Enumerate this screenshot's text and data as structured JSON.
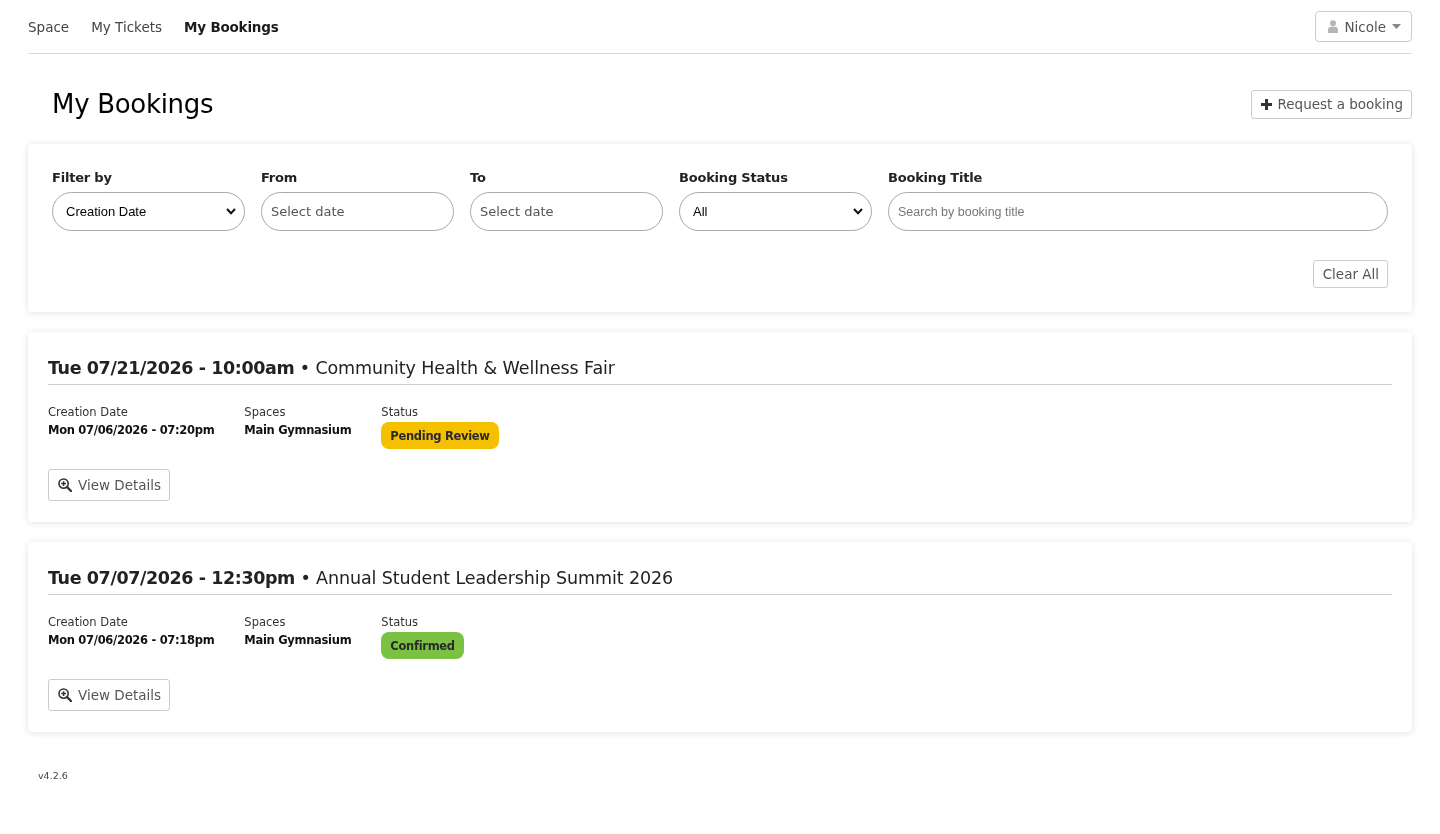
{
  "nav": {
    "tabs": [
      {
        "label": "Space",
        "selected": false
      },
      {
        "label": "My Tickets",
        "selected": false
      },
      {
        "label": "My Bookings",
        "selected": true
      }
    ],
    "user_menu": {
      "label": "Nicole"
    }
  },
  "page": {
    "title": "My Bookings",
    "request_button": "Request a booking"
  },
  "filters": {
    "fields": [
      {
        "kind": "select",
        "label": "Filter by",
        "value": "Creation Date"
      },
      {
        "kind": "date",
        "label": "From",
        "placeholder": "Select date"
      },
      {
        "kind": "date",
        "label": "To",
        "placeholder": "Select date"
      },
      {
        "kind": "select",
        "label": "Booking Status",
        "value": "All"
      },
      {
        "kind": "text",
        "label": "Booking Title",
        "placeholder": "Search by booking title"
      }
    ],
    "clear_button": "Clear All"
  },
  "bookings": [
    {
      "heading": "**Tue 07/21/2026 - 10:00am** • Community Health & Wellness Fair",
      "details": [
        {
          "label": "Creation Date",
          "value": "Mon 07/06/2026 - 07:20pm"
        },
        {
          "label": "Spaces",
          "value": "Main Gymnasium"
        }
      ],
      "status_label": "Status",
      "status": {
        "label": "Pending Review",
        "color": "#f5c000"
      },
      "action": "View Details"
    },
    {
      "heading": "**Tue 07/07/2026 - 12:30pm** • Annual Student Leadership Summit 2026",
      "details": [
        {
          "label": "Creation Date",
          "value": "Mon 07/06/2026 - 07:18pm"
        },
        {
          "label": "Spaces",
          "value": "Main Gymnasium"
        }
      ],
      "status_label": "Status",
      "status": {
        "label": "Confirmed",
        "color": "#7bc143"
      },
      "action": "View Details"
    }
  ],
  "version": "v4.2.6"
}
